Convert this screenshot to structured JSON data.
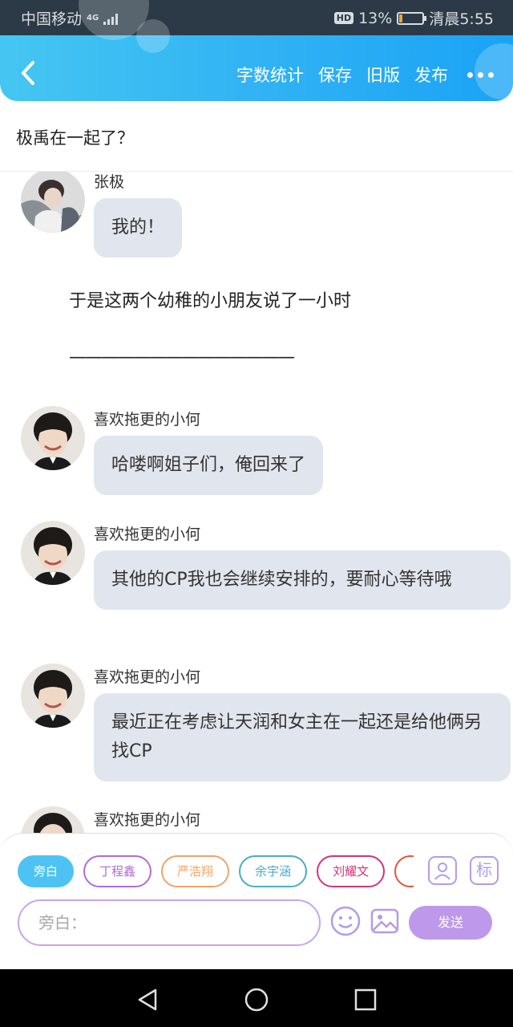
{
  "status_bar": {
    "carrier": "中国移动",
    "network": "4G",
    "hd": "HD",
    "battery": "13%",
    "battery_level": 0.13,
    "time": "清晨5:55"
  },
  "header": {
    "back_icon": "chevron-left-icon",
    "actions": [
      "字数统计",
      "保存",
      "旧版",
      "发布"
    ],
    "more_icon": "more-dots-icon"
  },
  "title": "极禹在一起了？",
  "messages": [
    {
      "sender": "张极",
      "text": "我的！"
    },
    {
      "narration": "于是这两个幼稚的小朋友说了一小时"
    },
    {
      "narration": "——————————————"
    },
    {
      "sender": "喜欢拖更的小何",
      "text": "哈喽啊姐子们，俺回来了"
    },
    {
      "sender": "喜欢拖更的小何",
      "text": "其他的CP我也会继续安排的，要耐心等待哦"
    },
    {
      "sender": "喜欢拖更的小何",
      "text": "最近正在考虑让天润和女主在一起还是给他俩另找CP"
    },
    {
      "sender": "喜欢拖更的小何"
    }
  ],
  "composer": {
    "chips": [
      {
        "label": "旁白",
        "color": "#4ec3f3",
        "active": true
      },
      {
        "label": "丁程鑫",
        "color": "#b06cd6"
      },
      {
        "label": "严浩翔",
        "color": "#f0a46a"
      },
      {
        "label": "余宇涵",
        "color": "#4aaec6"
      },
      {
        "label": "刘耀文",
        "color": "#d0357a"
      }
    ],
    "role_icon": "character-icon",
    "tag_icon": "标",
    "placeholder": "旁白：",
    "emoji_icon": "emoji-icon",
    "image_icon": "image-icon",
    "send": "发送"
  },
  "nav": {
    "back": "back-triangle-icon",
    "home": "home-circle-icon",
    "recent": "recent-square-icon"
  }
}
